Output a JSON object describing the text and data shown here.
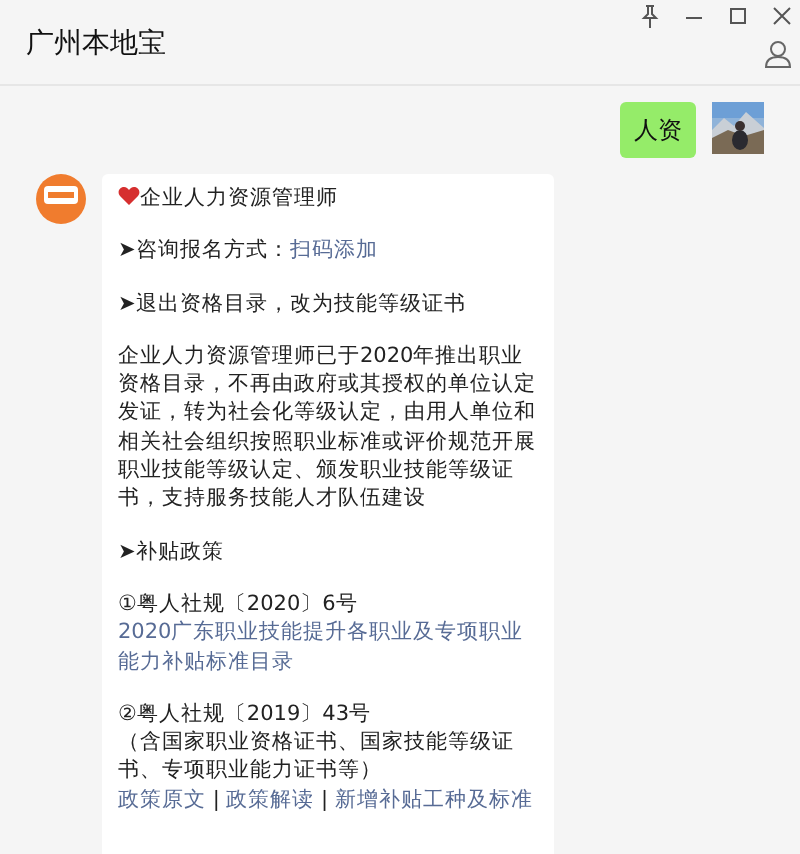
{
  "window": {
    "title": "广州本地宝"
  },
  "messages": [
    {
      "kind": "outgoing",
      "text": "人资"
    },
    {
      "kind": "incoming",
      "lines_groups": [
        [
          [
            {
              "kind": "heart"
            },
            {
              "kind": "text",
              "text": "企业人力资源管理师"
            }
          ]
        ],
        [
          [
            {
              "kind": "text",
              "text": "➤咨询报名方式："
            },
            {
              "kind": "link",
              "text": "扫码添加"
            }
          ]
        ],
        [
          [
            {
              "kind": "text",
              "text": "➤退出资格目录，改为技能等级证书"
            }
          ]
        ],
        [
          [
            {
              "kind": "text",
              "text": "企业人力资源管理师已于2020年推出职业资格目录，不再由政府或其授权的单位认定发证，转为社会化等级认定，由用人单位和相关社会组织按照职业标准或评价规范开展职业技能等级认定、颁发职业技能等级证书，支持服务技能人才队伍建设"
            }
          ]
        ],
        [
          [
            {
              "kind": "text",
              "text": "➤补贴政策"
            }
          ]
        ],
        [
          [
            {
              "kind": "text",
              "text": "①粤人社规〔2020〕6号"
            }
          ],
          [
            {
              "kind": "link",
              "text": "2020广东职业技能提升各职业及专项职业能力补贴标准目录"
            }
          ]
        ],
        [
          [
            {
              "kind": "text",
              "text": "②粤人社规〔2019〕43号"
            }
          ],
          [
            {
              "kind": "text",
              "text": "（含国家职业资格证书、国家技能等级证书、专项职业能力证书等）"
            }
          ],
          [
            {
              "kind": "link",
              "text": "政策原文"
            },
            {
              "kind": "text",
              "text": " | "
            },
            {
              "kind": "link",
              "text": "政策解读"
            },
            {
              "kind": "text",
              "text": " | "
            },
            {
              "kind": "link",
              "text": "新增补贴工种及标准"
            }
          ]
        ]
      ]
    }
  ]
}
